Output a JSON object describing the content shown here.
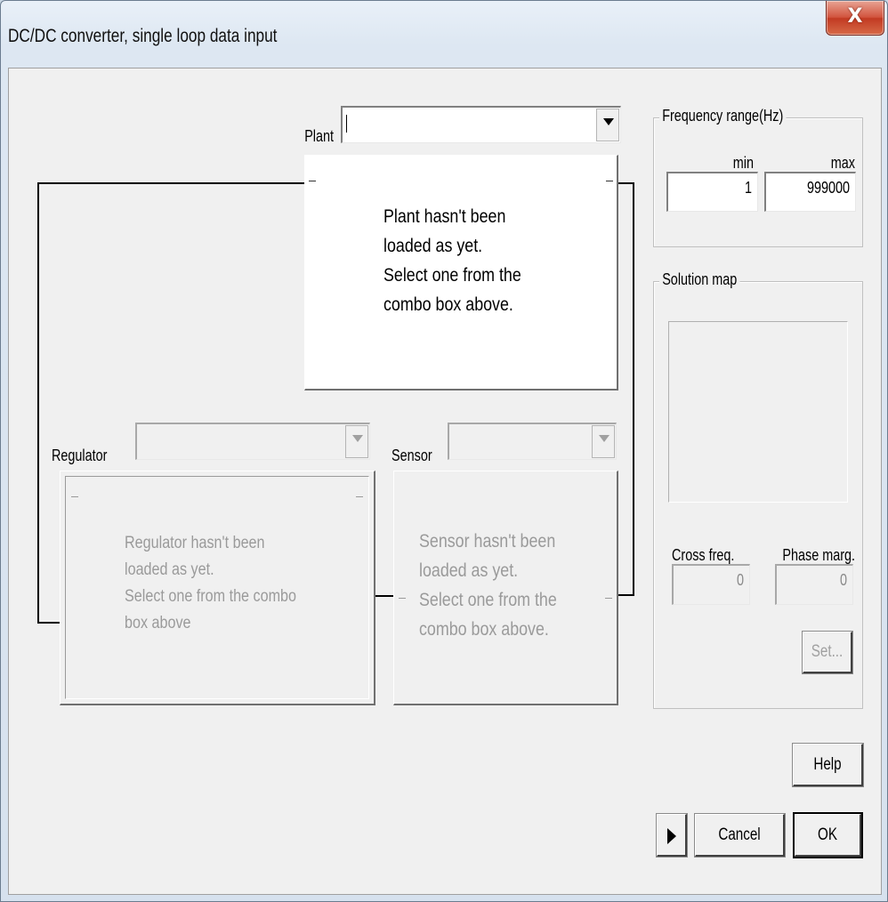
{
  "window": {
    "title": "DC/DC converter, single loop data input",
    "close_glyph": "X"
  },
  "plant": {
    "label": "Plant",
    "value": "",
    "message": [
      "Plant hasn't been",
      "loaded as yet.",
      "Select one from the",
      "combo box above."
    ]
  },
  "regulator": {
    "label": "Regulator",
    "value": "",
    "message": [
      "Regulator hasn't been",
      "loaded as yet.",
      "Select one from the combo",
      "box above"
    ]
  },
  "sensor": {
    "label": "Sensor",
    "value": "",
    "message": [
      "Sensor hasn't been",
      "loaded as yet.",
      "Select one from the",
      "combo box above."
    ]
  },
  "frequency_range": {
    "title": "Frequency range(Hz)",
    "min_label": "min",
    "max_label": "max",
    "min_value": "1",
    "max_value": "999000"
  },
  "solution_map": {
    "title": "Solution map",
    "cross_freq_label": "Cross freq.",
    "phase_marg_label": "Phase marg.",
    "cross_freq_value": "0",
    "phase_marg_value": "0",
    "set_label": "Set..."
  },
  "buttons": {
    "help": "Help",
    "cancel": "Cancel",
    "ok": "OK"
  },
  "icons": {
    "close": "close-icon",
    "dropdown": "chevron-down-icon",
    "expand": "play-arrow-icon"
  }
}
